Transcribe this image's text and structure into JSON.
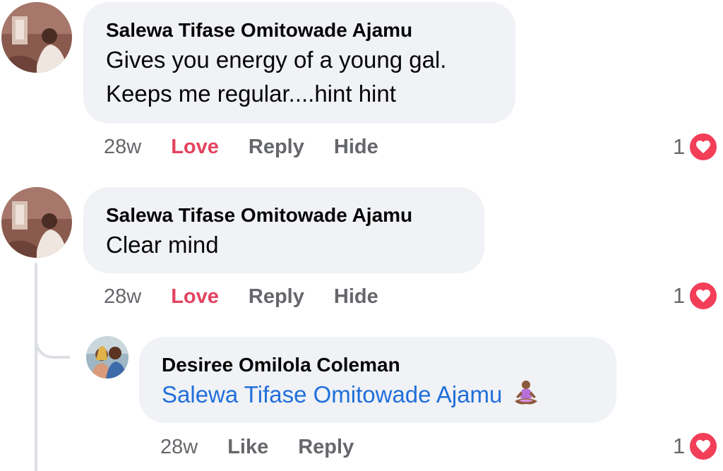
{
  "comments": [
    {
      "author": "Salewa Tifase Omitowade Ajamu",
      "lines": [
        "Gives you energy of a young gal.",
        "Keeps me regular....hint hint"
      ],
      "time": "28w",
      "actions": [
        "Love",
        "Reply",
        "Hide"
      ],
      "reaction_count": "1"
    },
    {
      "author": "Salewa Tifase Omitowade Ajamu",
      "lines": [
        "Clear mind"
      ],
      "time": "28w",
      "actions": [
        "Love",
        "Reply",
        "Hide"
      ],
      "reaction_count": "1"
    }
  ],
  "reply": {
    "author": "Desiree Omilola Coleman",
    "mention": "Salewa Tifase Omitowade Ajamu",
    "emoji": "person-in-lotus-position",
    "time": "28w",
    "actions": [
      "Like",
      "Reply"
    ],
    "reaction_count": "1"
  },
  "colors": {
    "bubble": "#f0f2f5",
    "love": "#e3435f",
    "mention": "#216fdb",
    "meta": "#65676b",
    "heart": "#f33e58"
  },
  "icons": {
    "reaction": "heart-reaction-icon"
  }
}
